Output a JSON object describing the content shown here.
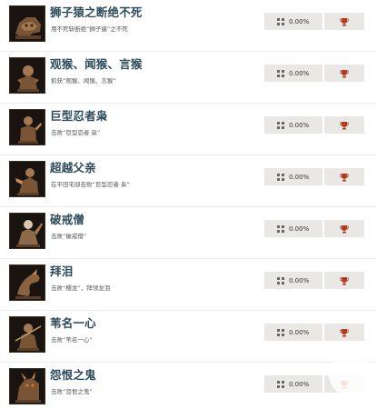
{
  "colors": {
    "title": "#2b4a5a",
    "desc": "#555555",
    "badge_bg": "#eae8e4",
    "trophy": "#b23c1e"
  },
  "achievements": [
    {
      "title": "狮子猿之断绝不死",
      "desc": "用不死斩断绝“狮子猿”之不死",
      "percent": "0.00%",
      "icon": "beast-skull-icon"
    },
    {
      "title": "观猴、闻猴、言猴",
      "desc": "抓获“观猴、闻猴、言猴”",
      "percent": "0.00%",
      "icon": "monkey-icon"
    },
    {
      "title": "巨型忍者枭",
      "desc": "击败“巨型忍者 枭”",
      "percent": "0.00%",
      "icon": "owl-warrior-icon"
    },
    {
      "title": "超越父亲",
      "desc": "在平田宅邸击败“巨型忍者 枭”",
      "percent": "0.00%",
      "icon": "owl-father-icon"
    },
    {
      "title": "破戒僧",
      "desc": "击败“破戒僧”",
      "percent": "0.00%",
      "icon": "corrupted-monk-icon"
    },
    {
      "title": "拜泪",
      "desc": "击败“樱龙”，拜领龙泪",
      "percent": "0.00%",
      "icon": "divine-dragon-icon"
    },
    {
      "title": "苇名一心",
      "desc": "击败“苇名一心”",
      "percent": "0.00%",
      "icon": "sword-saint-icon"
    },
    {
      "title": "怨恨之鬼",
      "desc": "击败“怨恨之鬼”",
      "percent": "0.00%",
      "icon": "demon-of-hatred-icon"
    }
  ]
}
